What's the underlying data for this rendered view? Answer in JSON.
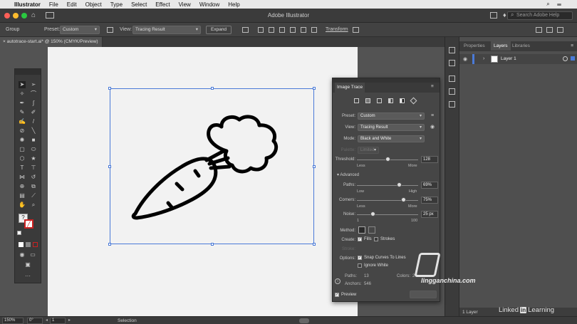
{
  "menubar": {
    "app": "Illustrator",
    "items": [
      "File",
      "Edit",
      "Object",
      "Type",
      "Select",
      "Effect",
      "View",
      "Window",
      "Help"
    ]
  },
  "titlebar": {
    "title": "Adobe Illustrator",
    "search_placeholder": "Search Adobe Help"
  },
  "controlbar": {
    "selection_label": "Group",
    "preset_label": "Preset:",
    "preset_value": "Custom",
    "view_label": "View:",
    "view_value": "Tracing Result",
    "expand_label": "Expand",
    "transform_label": "Transform"
  },
  "document": {
    "tab_label": "autotrace-start.ai* @ 150% (CMYK/Preview)"
  },
  "layers_panel": {
    "tabs": [
      "Properties",
      "Layers",
      "Libraries"
    ],
    "active_tab": "Layers",
    "layer_name": "Layer 1",
    "footer": "1 Layer"
  },
  "image_trace": {
    "title": "Image Trace",
    "preset_label": "Preset:",
    "preset_value": "Custom",
    "view_label": "View:",
    "view_value": "Tracing Result",
    "mode_label": "Mode:",
    "mode_value": "Black and White",
    "palette_label": "Palette:",
    "palette_value": "Limited",
    "threshold_label": "Threshold:",
    "threshold_value": "128",
    "threshold_fraction": 0.5,
    "threshold_min": "Less",
    "threshold_max": "More",
    "advanced_label": "Advanced",
    "paths_label": "Paths:",
    "paths_value": "69%",
    "paths_fraction": 0.69,
    "paths_min": "Low",
    "paths_max": "High",
    "corners_label": "Corners:",
    "corners_value": "75%",
    "corners_fraction": 0.75,
    "corners_min": "Less",
    "corners_max": "More",
    "noise_label": "Noise:",
    "noise_value": "25 px",
    "noise_fraction": 0.25,
    "noise_min": "1",
    "noise_max": "100",
    "method_label": "Method:",
    "create_label": "Create:",
    "fills_label": "Fills",
    "strokes_label": "Strokes",
    "stroke_label": "Stroke:",
    "options_label": "Options:",
    "snap_label": "Snap Curves To Lines",
    "ignore_white_label": "Ignore White",
    "paths_count_label": "Paths:",
    "paths_count": "13",
    "colors_label": "Colors:",
    "colors_count": "2",
    "anchors_label": "Anchors:",
    "anchors_count": "546",
    "preview_label": "Preview"
  },
  "statusbar": {
    "zoom": "150%",
    "rotation": "0°",
    "artboard": "1",
    "tool": "Selection"
  },
  "watermark": {
    "site": "lingganchina.com",
    "linkedin": "Linked",
    "learning": "Learning"
  },
  "colors": {
    "selection_blue": "#4a7ad8",
    "panel_bg": "#464646",
    "layer_blue": "#4a7ad8"
  }
}
